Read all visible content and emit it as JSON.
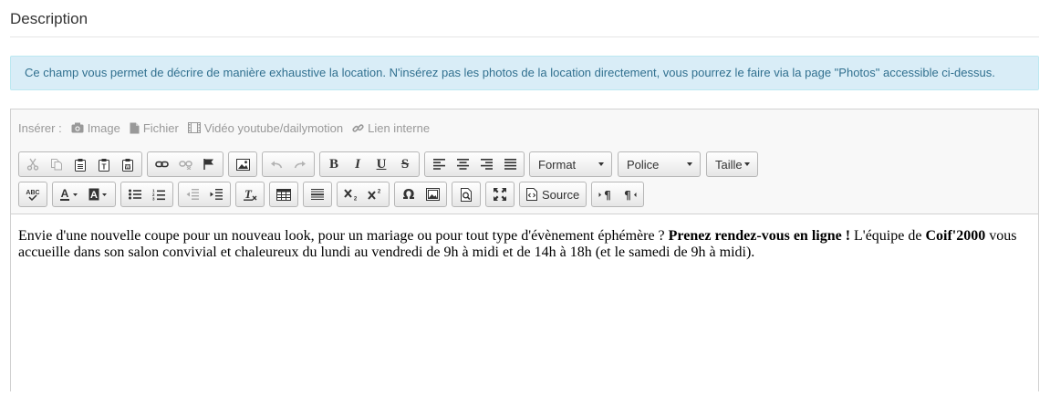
{
  "section": {
    "title": "Description"
  },
  "info": {
    "text": "Ce champ vous permet de décrire de manière exhaustive la location. N'insérez pas les photos de la location directement, vous pourrez le faire via la page \"Photos\" accessible ci-dessus."
  },
  "insert": {
    "label": "Insérer :",
    "items": [
      {
        "label": "Image",
        "icon": "camera-icon"
      },
      {
        "label": "Fichier",
        "icon": "file-icon"
      },
      {
        "label": "Vidéo youtube/dailymotion",
        "icon": "film-icon"
      },
      {
        "label": "Lien interne",
        "icon": "link-icon"
      }
    ]
  },
  "toolbar": {
    "bold": "B",
    "italic": "I",
    "underline": "U",
    "strike": "S",
    "format_label": "Format",
    "font_label": "Police",
    "size_label": "Taille",
    "source_label": "Source",
    "omega": "Ω"
  },
  "content": {
    "part1": "Envie d'une nouvelle coupe pour un nouveau look, pour un mariage ou pour tout type d'évènement éphémère ? ",
    "bold1": "Prenez rendez-vous en ligne !",
    "part2": " L'équipe de ",
    "bold2": "Coif'2000",
    "part3": " vous accueille dans son salon convivial et chaleureux du lundi au vendredi de 9h à midi et de 14h à 18h (et le samedi de 9h à midi)."
  }
}
